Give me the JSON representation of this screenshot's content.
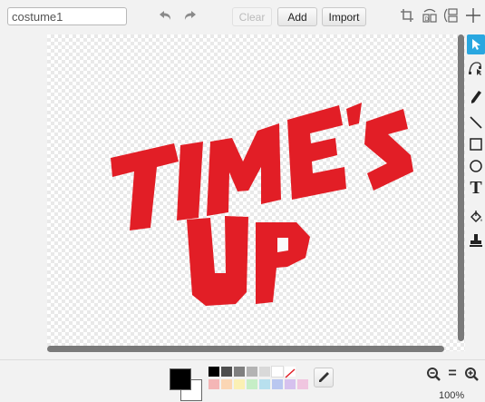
{
  "costume_name": {
    "value": "costume1"
  },
  "toolbar": {
    "clear": "Clear",
    "add": "Add",
    "import": "Import"
  },
  "artwork": {
    "line1": "TIME'S",
    "line2": "UP",
    "color": "#e21e26"
  },
  "colors": {
    "primary": "#000000",
    "secondary": "#ffffff"
  },
  "palette": {
    "row1": [
      "#000000",
      "#4d4d4d",
      "#7f7f7f",
      "#b3b3b3",
      "#d9d9d9",
      "#ffffff"
    ],
    "row2": [
      "#f4b6b6",
      "#fbd6b4",
      "#fbf0b4",
      "#c6eec6",
      "#b8e0ee",
      "#b9c7f0",
      "#d6c1ee",
      "#f0c6e0"
    ]
  },
  "icons": {
    "undo": "undo-icon",
    "redo": "redo-icon",
    "crop": "crop-icon",
    "flip": "flip-horizontal-icon",
    "flip_v": "flip-vertical-icon",
    "center": "set-center-icon",
    "select": "select-arrow-icon",
    "reshape": "reshape-icon",
    "pencil": "pencil-icon",
    "line": "line-icon",
    "rect": "rectangle-icon",
    "ellipse": "ellipse-icon",
    "text": "text-icon",
    "fill": "fill-bucket-icon",
    "stamp": "stamp-icon",
    "eyedropper": "eyedropper-icon",
    "zoom_out": "zoom-out-icon",
    "zoom_reset": "zoom-reset-icon",
    "zoom_in": "zoom-in-icon"
  },
  "tools": {
    "text_glyph": "T",
    "zoom_reset_glyph": "="
  },
  "zoom": {
    "level": "100%"
  }
}
